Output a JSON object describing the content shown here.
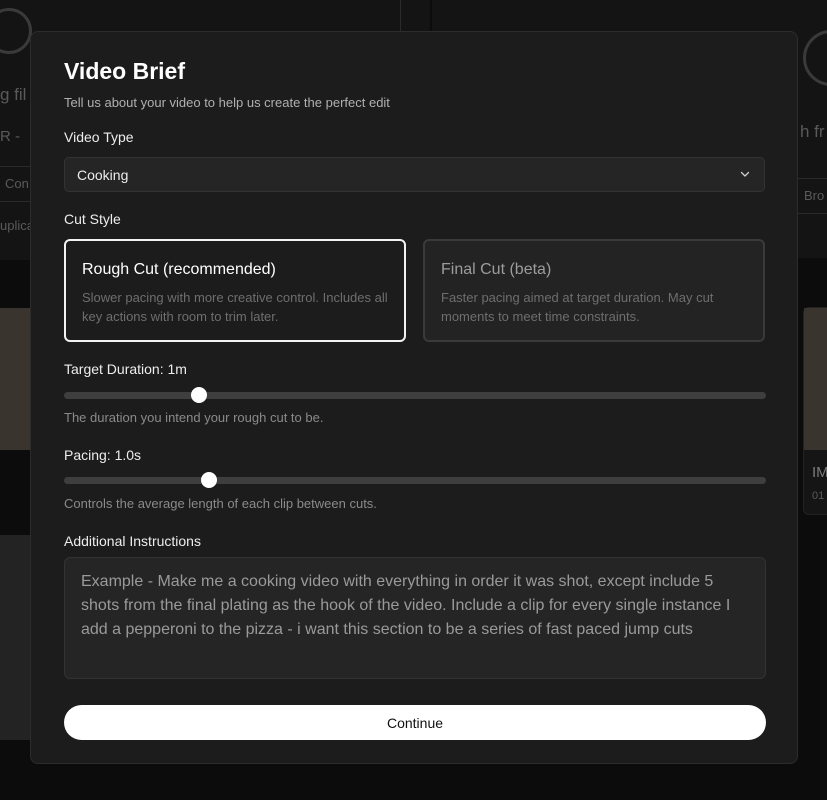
{
  "modal": {
    "title": "Video Brief",
    "subtitle": "Tell us about your video to help us create the perfect edit",
    "video_type": {
      "label": "Video Type",
      "selected": "Cooking"
    },
    "cut_style": {
      "label": "Cut Style",
      "options": [
        {
          "title": "Rough Cut (recommended)",
          "description": "Slower pacing with more creative control. Includes all key actions with room to trim later.",
          "selected": true
        },
        {
          "title": "Final Cut (beta)",
          "description": "Faster pacing aimed at target duration. May cut moments to meet time constraints.",
          "selected": false
        }
      ]
    },
    "target_duration": {
      "label": "Target Duration: 1m",
      "help": "The duration you intend your rough cut to be.",
      "value_fraction": 0.193
    },
    "pacing": {
      "label": "Pacing: 1.0s",
      "help": "Controls the average length of each clip between cuts.",
      "value_fraction": 0.207
    },
    "additional_instructions": {
      "label": "Additional Instructions",
      "placeholder": "Example - Make me a cooking video with everything in order it was shot, except include 5 shots from the final plating as the hook of the video. Include a clip for every single instance I add a pepperoni to the pizza - i want this section to be a series of fast paced jump cuts"
    },
    "continue_label": "Continue"
  },
  "background": {
    "left_texts": [
      "g fil",
      "R -",
      "Con",
      "uplica"
    ],
    "right_texts": [
      "h fr",
      "Bro",
      "IM",
      "01"
    ]
  },
  "colors": {
    "modal_bg": "#1c1c1c",
    "accent": "#ffffff",
    "page_bg": "#0c0c0c"
  }
}
